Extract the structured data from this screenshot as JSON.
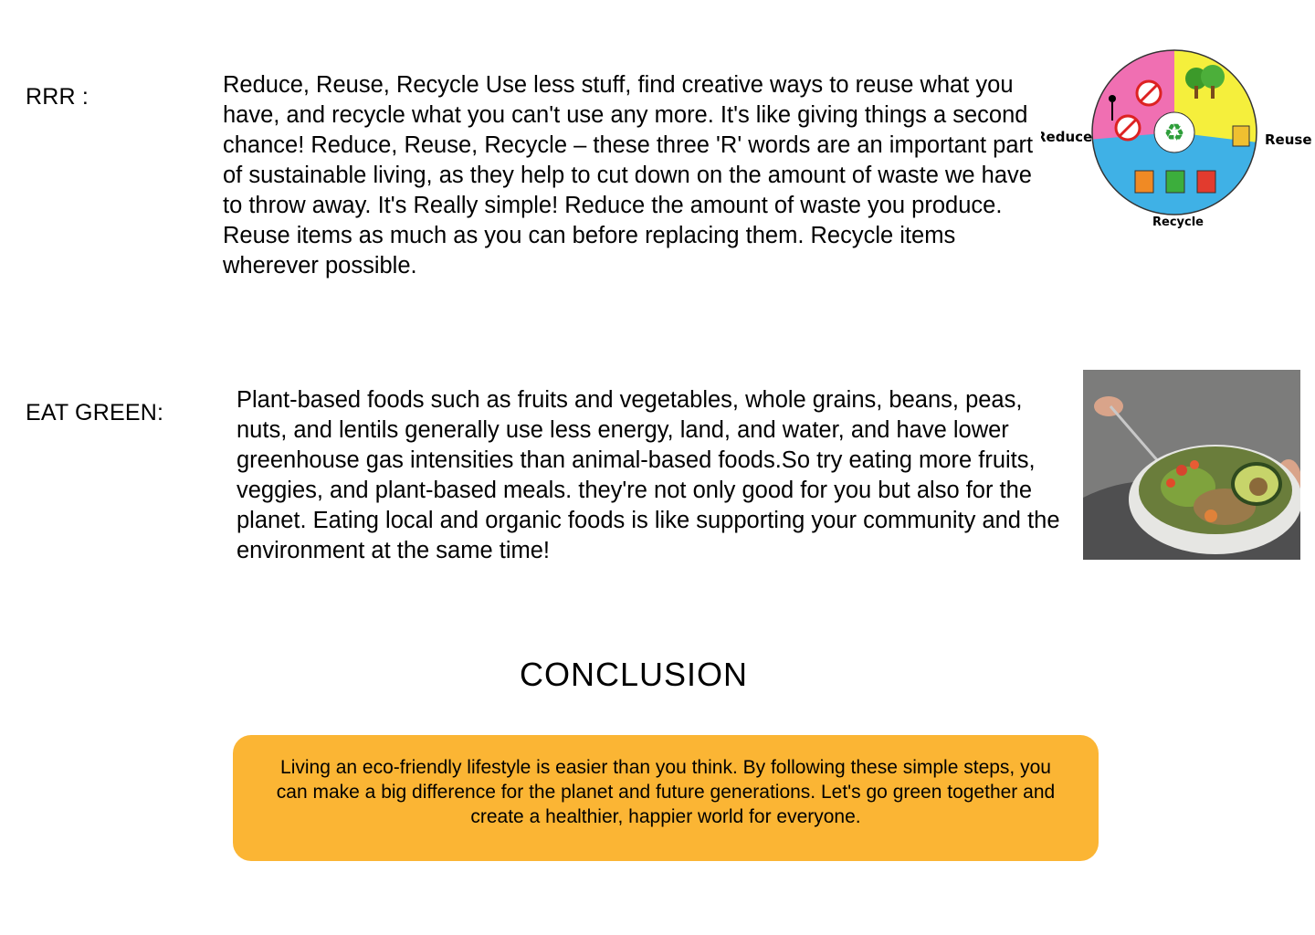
{
  "sections": {
    "rrr": {
      "label": "RRR :",
      "text": "Reduce, Reuse, Recycle Use less stuff, find creative ways to reuse what you have, and recycle what you can't use any more. It's like giving things a second chance! Reduce, Reuse, Recycle – these three 'R' words are an important part of sustainable living, as they help to cut down on the amount of waste we have to throw away. It's Really simple! Reduce the amount of waste you produce. Reuse items as much as you can before replacing them. Recycle items wherever possible.",
      "image": {
        "label_reduce": "Reduce",
        "label_reuse": "Reuse",
        "label_recycle": "Recycle"
      }
    },
    "eat_green": {
      "label": "EAT GREEN:",
      "text": "Plant-based foods such as fruits and vegetables, whole grains, beans, peas, nuts, and lentils generally use less energy, land, and water, and have lower greenhouse gas intensities than animal-based foods.So try eating more fruits, veggies, and plant-based meals. they're not only good for you but also for the planet. Eating local and organic foods is like supporting your community and the environment at the same time!"
    }
  },
  "conclusion": {
    "title": "CONCLUSION",
    "text": "Living an eco-friendly lifestyle is easier than you think. By following these simple steps, you can make a big difference for the planet and future generations. Let's go green together and create a healthier, happier world for everyone.",
    "box_color": "#fbb534"
  },
  "colors": {
    "wheel_pink": "#f06fb2",
    "wheel_yellow": "#f5ef3c",
    "wheel_blue": "#3fb1e6",
    "wheel_green": "#4caf50"
  }
}
